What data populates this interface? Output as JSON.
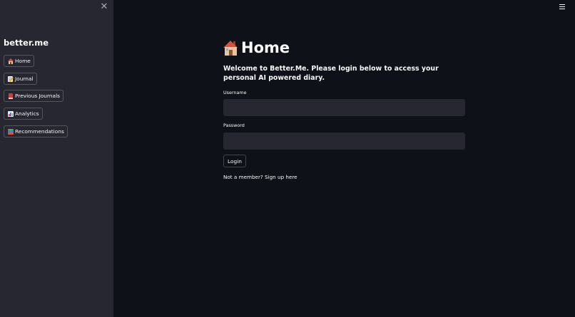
{
  "sidebar": {
    "close_glyph": "✕",
    "brand": "better.me",
    "items": [
      {
        "label": "Home",
        "icon": "house-icon"
      },
      {
        "label": "Journal",
        "icon": "memo-icon"
      },
      {
        "label": "Previous Journals",
        "icon": "book-icon"
      },
      {
        "label": "Analytics",
        "icon": "bar-chart-icon"
      },
      {
        "label": "Recommendations",
        "icon": "books-icon"
      }
    ]
  },
  "main": {
    "title": "Home",
    "title_icon": "house-icon",
    "welcome": "Welcome to Better.Me. Please login below to access your personal AI powered diary.",
    "username": {
      "label": "Username",
      "value": "",
      "placeholder": ""
    },
    "password": {
      "label": "Password",
      "value": "",
      "placeholder": ""
    },
    "login_label": "Login",
    "signup_prefix": "Not a member?",
    "signup_link": "Sign up here"
  },
  "colors": {
    "background": "#0e1117",
    "sidebar": "#262730",
    "input": "#262730",
    "text": "#fafafa"
  }
}
